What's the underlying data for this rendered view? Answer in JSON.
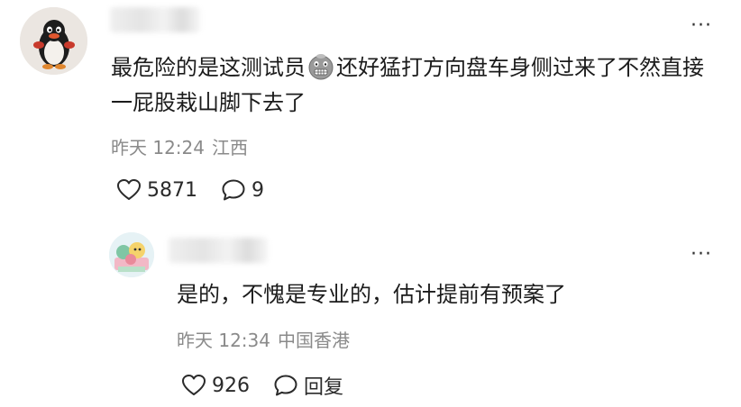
{
  "comment": {
    "text_before": "最危险的是这测试员",
    "text_after": "还好猛打方向盘车身侧过来了不然直接一屁股栽山脚下去了",
    "time": "昨天 12:24",
    "location": "江西",
    "like_count": "5871",
    "reply_count": "9",
    "more_label": "···",
    "emoji_icon": "grimace-emoji-icon"
  },
  "reply": {
    "text": "是的，不愧是专业的，估计提前有预案了",
    "time": "昨天 12:34",
    "location": "中国香港",
    "like_count": "926",
    "reply_label": "回复",
    "more_label": "···"
  },
  "colors": {
    "text": "#1b1b1b",
    "meta": "#8a8a8a",
    "icon": "#2a2a2a"
  }
}
